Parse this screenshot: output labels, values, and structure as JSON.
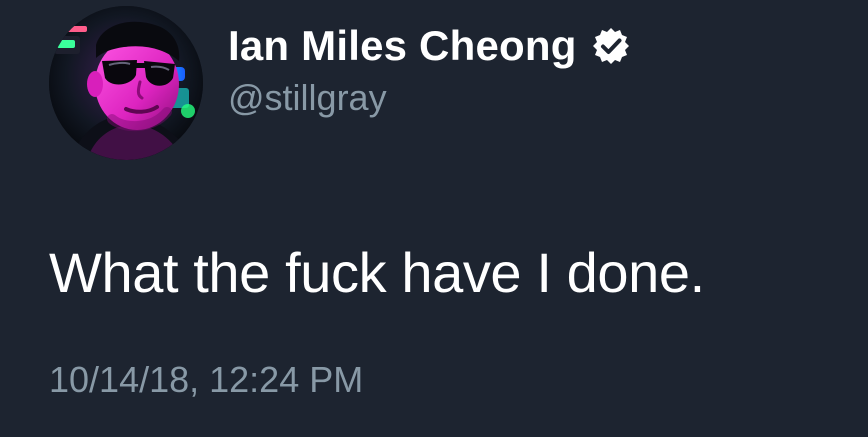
{
  "tweet": {
    "user": {
      "display_name": "Ian Miles Cheong",
      "handle": "@stillgray",
      "verified_icon": "verified-badge-icon",
      "avatar_icon": "avatar-photo"
    },
    "text": "What the fuck have I done.",
    "timestamp": "10/14/18, 12:24 PM"
  },
  "colors": {
    "background": "#1d2430",
    "primary_text": "#ffffff",
    "secondary_text": "#8899a6",
    "accent_magenta": "#ff2bd6"
  }
}
